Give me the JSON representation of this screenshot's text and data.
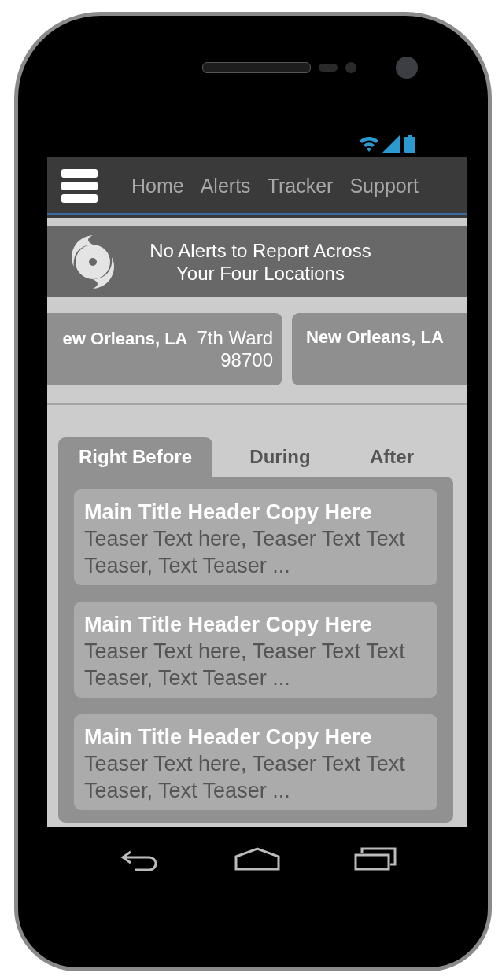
{
  "nav": {
    "items": [
      "Home",
      "Alerts",
      "Tracker",
      "Support"
    ]
  },
  "banner": {
    "text": "No Alerts to Report Across Your Four Locations"
  },
  "locations": [
    {
      "city": "ew Orleans, LA",
      "area": "7th Ward",
      "zip": "98700"
    },
    {
      "city": "New Orleans, LA"
    }
  ],
  "tabs": [
    {
      "label": "Right Before",
      "selected": true
    },
    {
      "label": "During",
      "selected": false
    },
    {
      "label": "After",
      "selected": false
    }
  ],
  "articles": [
    {
      "title": "Main Title Header Copy Here",
      "teaser": "Teaser Text here, Teaser Text Text Teaser, Text Teaser ..."
    },
    {
      "title": "Main Title Header Copy Here",
      "teaser": "Teaser Text here, Teaser Text Text Teaser, Text Teaser ..."
    },
    {
      "title": "Main Title Header Copy Here",
      "teaser": "Teaser Text here, Teaser Text Text Teaser, Text Teaser ..."
    }
  ]
}
